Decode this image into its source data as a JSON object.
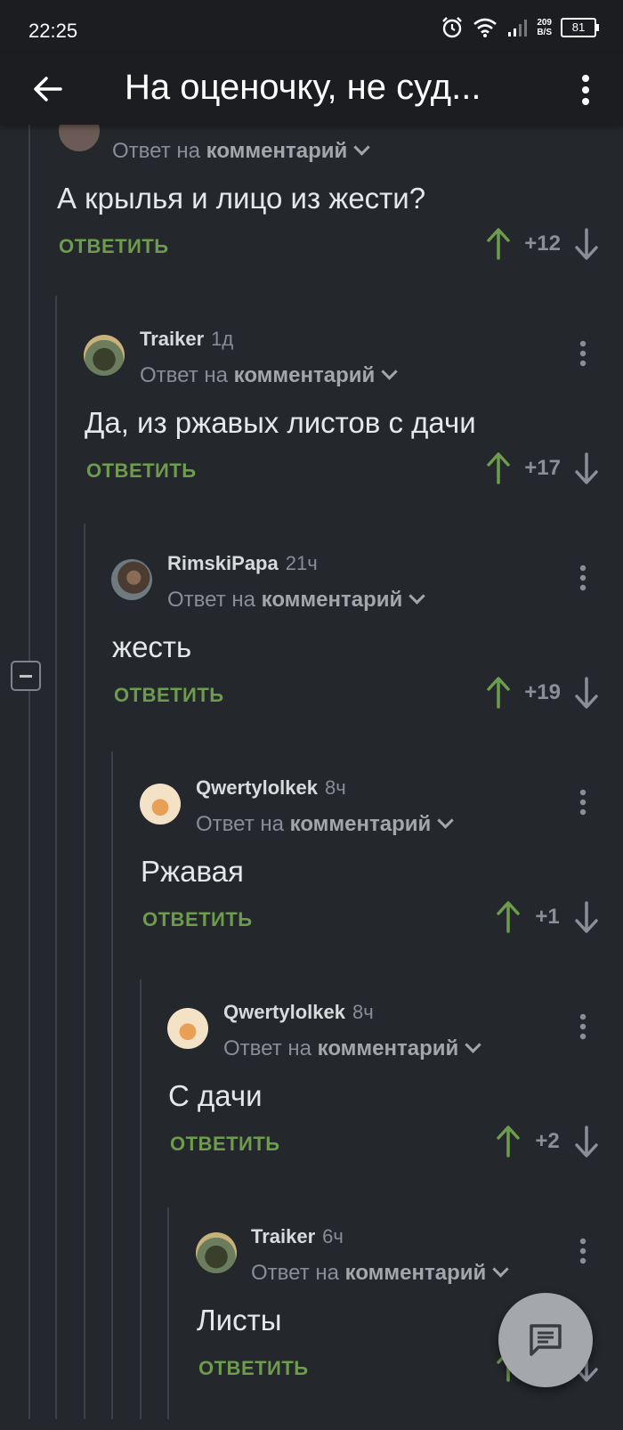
{
  "status_bar": {
    "time": "22:25",
    "net_speed_value": "209",
    "net_speed_unit": "B/S",
    "battery": "81"
  },
  "app_bar": {
    "title": "На оценочку, не суд..."
  },
  "labels": {
    "reply_to_prefix": "Ответ на",
    "reply_to_target": "комментарий",
    "reply_button": "ОТВЕТИТЬ"
  },
  "comments": [
    {
      "author": "",
      "time": "",
      "text": "А крылья и лицо из жести?",
      "score": "+12"
    },
    {
      "author": "Traiker",
      "time": "1д",
      "text": "Да, из ржавых листов с дачи",
      "score": "+17"
    },
    {
      "author": "RimskiPapa",
      "time": "21ч",
      "text": "жесть",
      "score": "+19"
    },
    {
      "author": "Qwertylolkek",
      "time": "8ч",
      "text": "Ржавая",
      "score": "+1"
    },
    {
      "author": "Qwertylolkek",
      "time": "8ч",
      "text": "С дачи",
      "score": "+2"
    },
    {
      "author": "Traiker",
      "time": "6ч",
      "text": "Листы",
      "score": ""
    }
  ],
  "colors": {
    "background": "#24272c",
    "app_bar": "#1b1d21",
    "upvote": "#6d9c4c",
    "reply_button": "#6d9c4c",
    "muted_text": "#8a8d93",
    "fab": "#a4a7ac"
  },
  "icons": {
    "back": "arrow-left",
    "menu": "vertical-dots",
    "upvote": "arrow-up",
    "downvote": "arrow-down",
    "collapse": "minus-square",
    "fab": "comment-icon"
  }
}
